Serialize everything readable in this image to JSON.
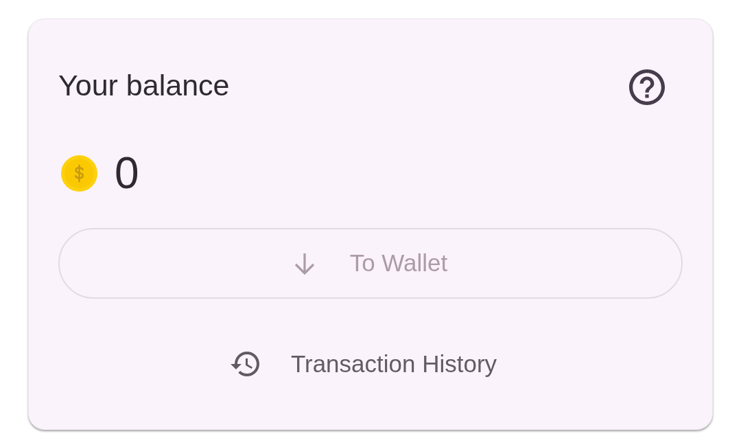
{
  "card": {
    "title": "Your balance",
    "balance": "0",
    "to_wallet_button": {
      "label": "To Wallet",
      "disabled": true
    },
    "history_button": {
      "label": "Transaction History"
    }
  }
}
